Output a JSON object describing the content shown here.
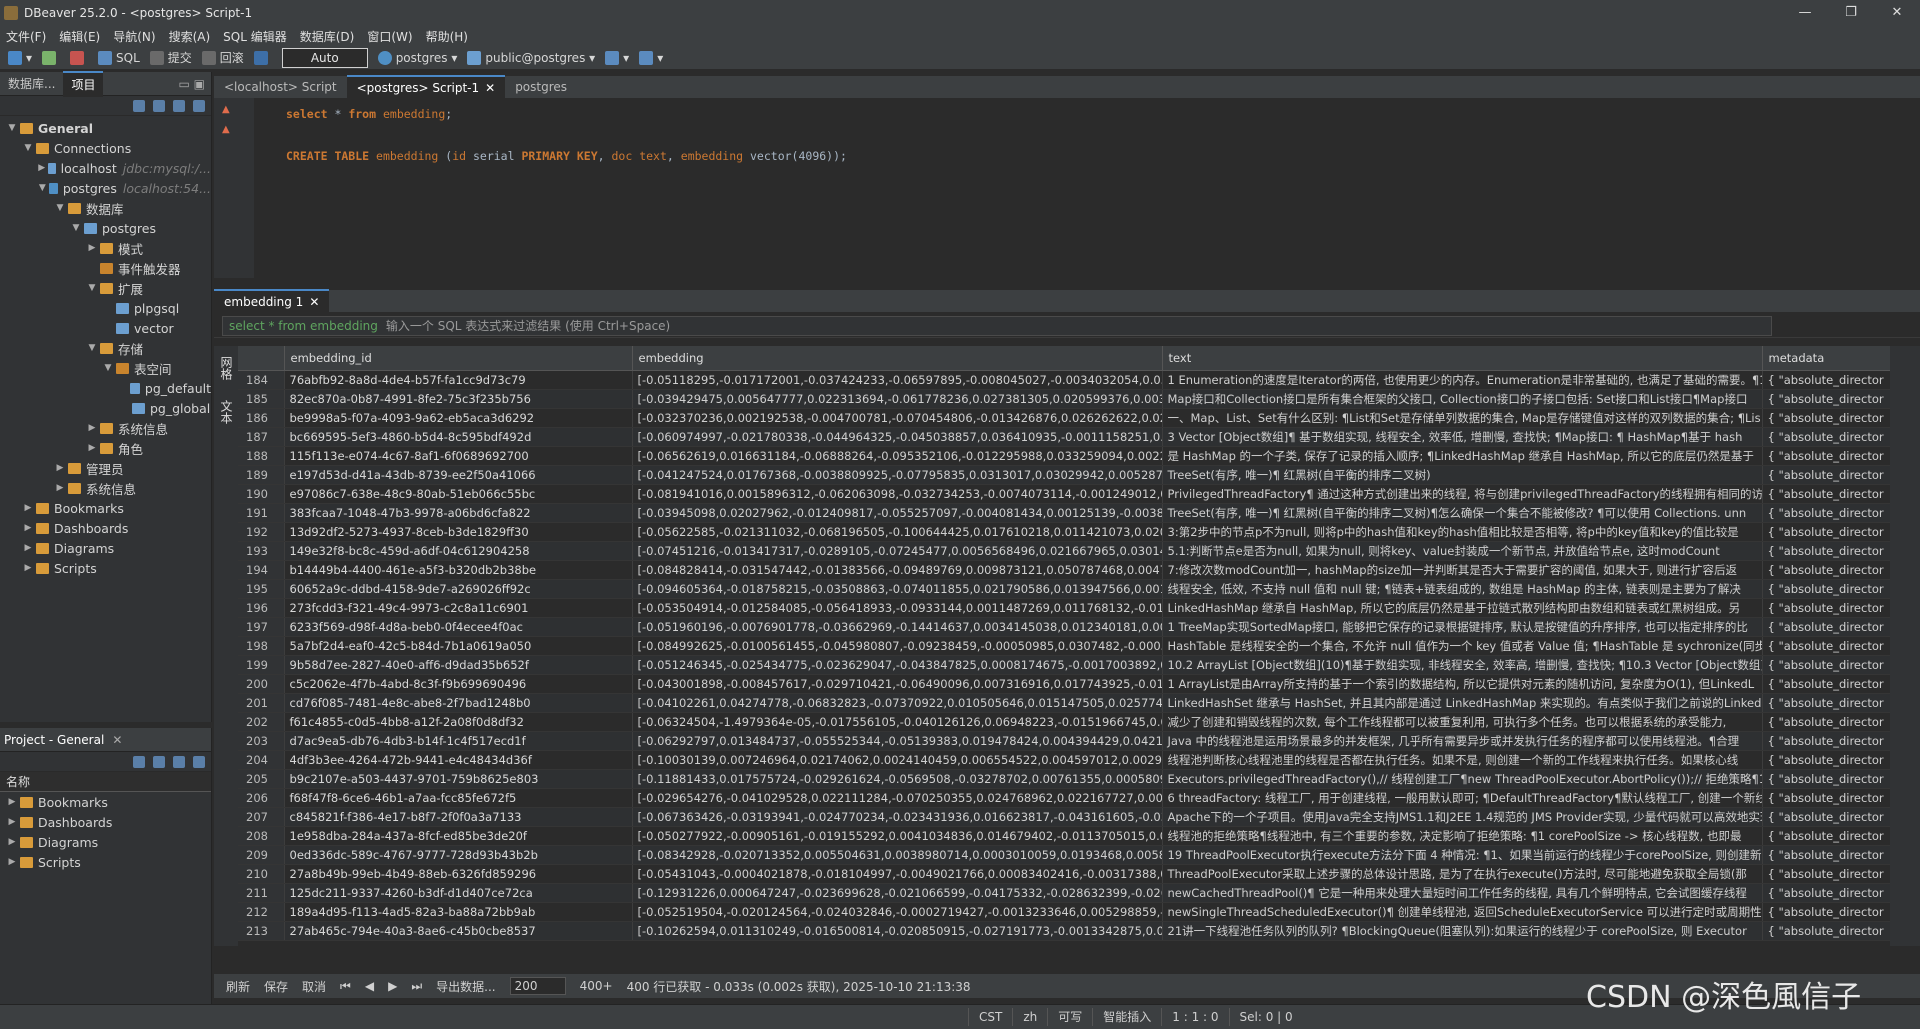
{
  "window": {
    "title": "DBeaver 25.2.0 - <postgres> Script-1",
    "controls": [
      "—",
      "❐",
      "✕"
    ]
  },
  "menu": [
    "文件(F)",
    "编辑(E)",
    "导航(N)",
    "搜索(A)",
    "SQL 编辑器",
    "数据库(D)",
    "窗口(W)",
    "帮助(H)"
  ],
  "toolbar": {
    "sql": "SQL",
    "commit": "提交",
    "rollback": "回滚",
    "auto": "Auto",
    "connection": "postgres",
    "schema": "public@postgres"
  },
  "left": {
    "tabs": [
      "数据库...",
      "项目"
    ],
    "tree": [
      {
        "label": "General",
        "level": 0,
        "arrow": "▼",
        "icon": "fold"
      },
      {
        "label": "Connections",
        "level": 1,
        "arrow": "▼",
        "icon": "fold"
      },
      {
        "label": "localhost",
        "hint": "jdbc:mysql:/...",
        "level": 2,
        "arrow": "▶",
        "icon": "dbi"
      },
      {
        "label": "postgres",
        "hint": "localhost:54...",
        "level": 2,
        "arrow": "▼",
        "icon": "pgi"
      },
      {
        "label": "数据库",
        "level": 3,
        "arrow": "▼",
        "icon": "fold"
      },
      {
        "label": "postgres",
        "level": 4,
        "arrow": "▼",
        "icon": "dbi"
      },
      {
        "label": "模式",
        "level": 5,
        "arrow": "▶",
        "icon": "fold"
      },
      {
        "label": "事件触发器",
        "level": 5,
        "arrow": "",
        "icon": "fold2"
      },
      {
        "label": "扩展",
        "level": 5,
        "arrow": "▼",
        "icon": "fold"
      },
      {
        "label": "plpgsql",
        "level": 6,
        "arrow": "",
        "icon": "dbi"
      },
      {
        "label": "vector",
        "level": 6,
        "arrow": "",
        "icon": "dbi"
      },
      {
        "label": "存储",
        "level": 5,
        "arrow": "▼",
        "icon": "fold"
      },
      {
        "label": "表空间",
        "level": 6,
        "arrow": "▼",
        "icon": "fold2"
      },
      {
        "label": "pg_default",
        "level": 7,
        "arrow": "",
        "icon": "dbi"
      },
      {
        "label": "pg_global",
        "level": 7,
        "arrow": "",
        "icon": "dbi"
      },
      {
        "label": "系统信息",
        "level": 5,
        "arrow": "▶",
        "icon": "fold"
      },
      {
        "label": "角色",
        "level": 5,
        "arrow": "▶",
        "icon": "fold"
      },
      {
        "label": "管理员",
        "level": 3,
        "arrow": "▶",
        "icon": "fold"
      },
      {
        "label": "系统信息",
        "level": 3,
        "arrow": "▶",
        "icon": "fold"
      },
      {
        "label": "Bookmarks",
        "level": 1,
        "arrow": "▶",
        "icon": "fold"
      },
      {
        "label": "Dashboards",
        "level": 1,
        "arrow": "▶",
        "icon": "fold"
      },
      {
        "label": "Diagrams",
        "level": 1,
        "arrow": "▶",
        "icon": "fold"
      },
      {
        "label": "Scripts",
        "level": 1,
        "arrow": "▶",
        "icon": "fold"
      }
    ]
  },
  "project": {
    "title": "Project - General",
    "column": "名称",
    "items": [
      "Bookmarks",
      "Dashboards",
      "Diagrams",
      "Scripts"
    ]
  },
  "editor": {
    "tabs": [
      "<localhost> Script",
      "<postgres> Script-1",
      "postgres"
    ],
    "lines": [
      {
        "parts": [
          [
            "kw",
            "select"
          ],
          [
            "tx",
            " * "
          ],
          [
            "kw",
            "from"
          ],
          [
            "tx",
            " "
          ],
          [
            "id",
            "embedding"
          ],
          [
            "tx",
            ";"
          ]
        ]
      },
      {
        "parts": []
      },
      {
        "parts": [
          [
            "kw",
            "CREATE TABLE"
          ],
          [
            "tx",
            " "
          ],
          [
            "id",
            "embedding"
          ],
          [
            "tx",
            " ("
          ],
          [
            "id",
            "id"
          ],
          [
            "tx",
            " serial "
          ],
          [
            "kw",
            "PRIMARY KEY"
          ],
          [
            "tx",
            ", "
          ],
          [
            "id",
            "doc"
          ],
          [
            "tx",
            " "
          ],
          [
            "id",
            "text"
          ],
          [
            "tx",
            ", "
          ],
          [
            "id",
            "embedding"
          ],
          [
            "tx",
            " vector(4096));"
          ]
        ]
      }
    ]
  },
  "results": {
    "tab": "embedding 1",
    "filter_sql": "select * from embedding",
    "filter_placeholder": "输入一个 SQL 表达式来过滤结果 (使用 Ctrl+Space)",
    "side_labels": [
      "网格",
      "文本"
    ],
    "columns": [
      "embedding_id",
      "embedding",
      "text",
      "metadata"
    ],
    "rows": [
      [
        "184",
        "76abfb92-8a8d-4de4-b57f-fa1cc9d73c79",
        "[-0.05118295,-0.017172001,-0.037424233,-0.06597895,-0.008045027,-0.0034032054,0.05695964,-0.0133",
        "1 Enumeration的速度是Iterator的两倍, 也使用更少的内存。Enumeration是非常基础的, 也满足了基础的需要。¶1",
        "{ \"absolute_director"
      ],
      [
        "185",
        "82ec870a-0b87-4991-8fe2-75c3f235b756",
        "[-0.039429475,0.005647777,0.022313694,-0.061778236,0.027381305,0.020599376,0.0031756589,0.00174",
        "Map接口和Collection接口是所有集合框架的父接口, Collection接口的子接口包括: Set接口和List接口¶Map接口",
        "{ \"absolute_director"
      ],
      [
        "186",
        "be9998a5-f07a-4093-9a62-eb5aca3d6292",
        "[-0.032370236,0.002192538,-0.004700781,-0.070454806,-0.013426876,0.026262622,0.024015635,-0.0109",
        "一、Map、List、Set有什么区别: ¶List和Set是存储单列数据的集合, Map是存储键值对这样的双列数据的集合; ¶Lis",
        "{ \"absolute_director"
      ],
      [
        "187",
        "bc669595-5ef3-4860-b5d4-8c595bdf492d",
        "[-0.060974997,-0.021780338,-0.044964325,-0.045038857,0.036410935,-0.0011158251,0.007193926,0.007",
        "3 Vector [Object数组]¶ 基于数组实现, 线程安全, 效率低, 增删慢, 查找快; ¶Map接口: ¶ HashMap¶基于 hash",
        "{ \"absolute_director"
      ],
      [
        "188",
        "115f113e-e074-4c67-8af1-6f0689692700",
        "[-0.06562619,0.016631184,-0.06888264,-0.095352106,-0.012295988,0.033259094,0.0022778378,0.002736",
        "是 HashMap 的一个子类, 保存了记录的插入顺序; ¶LinkedHashMap 继承自 HashMap, 所以它的底层仍然是基于",
        "{ \"absolute_director"
      ],
      [
        "189",
        "e197d53d-d41a-43db-8739-ee2f50a41066",
        "[-0.041247524,0.01767368,-0.0038809925,-0.07795835,0.0313017,0.03029942,0.0052877376,0.00107049",
        "TreeSet(有序, 唯一)¶ 红黑树(自平衡的排序二叉树)",
        "{ \"absolute_director"
      ],
      [
        "190",
        "e97086c7-638e-48c9-80ab-51eb066c55bc",
        "[-0.081941016,0.0015896312,-0.062063098,-0.032734253,-0.0074073114,-0.001249012,0.03447626,0.022",
        "PrivilegedThreadFactory¶ 通过这种方式创建出来的线程, 将与创建privilegedThreadFactory的线程拥有相同的访",
        "{ \"absolute_director"
      ],
      [
        "191",
        "383fcaa7-1048-47b3-9978-a06bd6cfa822",
        "[-0.03945098,0.02027962,-0.012409817,-0.055257097,-0.004081434,0.00125139,-0.0038218128,-0.00498",
        "TreeSet(有序, 唯一)¶ 红黑树(自平衡的排序二叉树)¶怎么确保一个集合不能被修改? ¶可以使用 Collections. unn",
        "{ \"absolute_director"
      ],
      [
        "192",
        "13d92df2-5273-4937-8ceb-b3de1829ff30",
        "[-0.05622585,-0.021311032,-0.068196505,-0.100644425,0.017610218,0.011421073,0.020693908,-0.06463",
        "3:第2步中的节点p不为null, 则将p中的hash值和key的hash值相比较是否相等, 将p中的key值和key的值比较是",
        "{ \"absolute_director"
      ],
      [
        "193",
        "149e32f8-bc8c-459d-a6df-04c612904258",
        "[-0.07451216,-0.013417317,-0.0289105,-0.07245477,0.0056568496,0.021667965,0.030141573,-0.0406302",
        "5.1:判断节点e是否为null, 如果为null, 则将key、value封装成一个新节点, 并放值给节点e, 这时modCount",
        "{ \"absolute_director"
      ],
      [
        "194",
        "b14449b4-4400-461e-a5f3-b320db2b38be",
        "[-0.084828414,-0.031547442,-0.01383566,-0.09489769,0.009873121,0.050787468,0.0047662323,0.002242",
        "7:修改次数modCount加一, hashMap的size加一并判断其是否大于需要扩容的阈值, 如果大于, 则进行扩容后返",
        "{ \"absolute_director"
      ],
      [
        "195",
        "60652a9c-ddbd-4158-9de7-a269026ff92c",
        "[-0.094605364,-0.018758215,-0.03508863,-0.074011855,0.021790586,0.013947566,0.00160223,-0.0029",
        "线程安全, 低效, 不支持 null 值和 null 键; ¶链表+链表组成的, 数组是 HashMap 的主体, 链表则是主要为了解决",
        "{ \"absolute_director"
      ],
      [
        "196",
        "273fcdd3-f321-49c4-9973-c2c8a11c6901",
        "[-0.053504914,-0.012584085,-0.056418933,-0.0933144,0.0011487269,0.011768132,-0.014254693,-0.0089",
        "LinkedHashMap 继承自 HashMap, 所以它的底层仍然是基于拉链式散列结构即由数组和链表或红黑树组成。另",
        "{ \"absolute_director"
      ],
      [
        "197",
        "6233f569-d98f-4d8a-beb0-0f4ecee4f0ac",
        "[-0.051960196,-0.0076901778,-0.03662969,-0.14414637,0.0034145038,0.012340181,0.0046085264,0.0128",
        "1 TreeMap实现SortedMap接口, 能够把它保存的记录根据键排序, 默认是按键值的升序排序, 也可以指定排序的比",
        "{ \"absolute_director"
      ],
      [
        "198",
        "5a7bf2d4-eaf0-42c5-b84d-7b1a0619a050",
        "[-0.084992625,-0.0100561455,-0.045980807,-0.09238459,-0.00050985,0.0307482,-0.00058315234,-0.0077",
        "HashTable 是线程安全的一个集合, 不允许 null 值作为一个 key 值或者 Value 值; ¶HashTable 是 sychronize(同步化",
        "{ \"absolute_director"
      ],
      [
        "199",
        "9b58d7ee-2827-40e0-aff6-d9dad35b652f",
        "[-0.051246345,-0.025434775,-0.023629047,-0.043847825,0.0008174675,-0.0017003892,0.006924023,0.03",
        "10.2 ArrayList [Object数组](10)¶基于数组实现, 非线程安全, 效率高, 增删慢, 查找快; ¶10.3 Vector [Object数组]",
        "{ \"absolute_director"
      ],
      [
        "200",
        "c5c2062e-4f7b-4abd-8c3f-f9b699690496",
        "[-0.043001898,-0.008457617,-0.029710421,-0.06490096,0.007316916,0.017743925,-0.014145091,-0.0080",
        "1 ArrayList是由Array所支持的基于一个索引的数据结构, 所以它提供对元素的随机访问, 复杂度为O(1), 但LinkedL",
        "{ \"absolute_director"
      ],
      [
        "201",
        "cd76f085-7481-4e8c-abe8-2f7bad1248b0",
        "[-0.04102261,0.04274778,-0.06832823,-0.07370922,0.010505646,0.015147505,0.025774555,-0.011507188",
        "LinkedHashSet 继承与 HashSet, 并且其内部是通过 LinkedHashMap 来实现的。有点类似于我们之前说的Linked",
        "{ \"absolute_director"
      ],
      [
        "202",
        "f61c4855-c0d5-4bb8-a12f-2a08f0d8df32",
        "[-0.06324504,-1.4979364e-05,-0.017556105,-0.040126126,0.06948223,-0.0151966745,0.006931286,-0.05",
        "减少了创建和销毁线程的次数, 每个工作线程都可以被重复利用, 可执行多个任务。也可以根据系统的承受能力,",
        "{ \"absolute_director"
      ],
      [
        "203",
        "d7ac9ea5-db76-4db3-b14f-1c4f517ecd1f",
        "[-0.06292797,0.013484737,-0.055525344,-0.05139383,0.019478424,0.004394429,0.04212634,-0.00594142",
        "Java 中的线程池是运用场景最多的并发框架, 几乎所有需要异步或并发执行任务的程序都可以使用线程池。¶合理",
        "{ \"absolute_director"
      ],
      [
        "204",
        "4df3b3ee-4264-472b-9441-e4c48434d36f",
        "[-0.10030139,0.007246964,0.02174062,0.0024140459,0.006554522,0.004597012,0.0029455153,-0.01344",
        "线程池判断核心线程池里的线程是否都在执行任务。如果不是, 则创建一个新的工作线程来执行任务。如果核心线",
        "{ \"absolute_director"
      ],
      [
        "205",
        "b9c2107e-a503-4437-9701-759b8625e803",
        "[-0.11881433,0.017575724,-0.029261624,-0.0569508,-0.03278702,0.00761355,0.0005809418,-0.00085247",
        "Executors.privilegedThreadFactory(),// 线程创建工厂¶new ThreadPoolExecutor.AbortPolicy());// 拒绝策略¶1线",
        "{ \"absolute_director"
      ],
      [
        "206",
        "f68f47f8-6ce6-46b1-a7aa-fcc85fe672f5",
        "[-0.029654276,-0.041029528,0.022111284,-0.070250355,0.024768962,0.022167727,0.0013223081,0.011122",
        "6 threadFactory: 线程工厂, 用于创建线程, 一般用默认即可; ¶DefaultThreadFactory¶默认线程工厂, 创建一个新线",
        "{ \"absolute_director"
      ],
      [
        "207",
        "c845821f-f386-4e17-b8f7-2f0f0a3a7133",
        "[-0.067363426,-0.03193941,-0.024770234,-0.023431936,0.016623817,-0.043161605,-0.039934292,0.07240",
        "Apache下的一个子项目。使用Java完全支持JMS1.1和J2EE 1.4规范的 JMS Provider实现, 少量代码就可以高效地实现",
        "{ \"absolute_director"
      ],
      [
        "208",
        "1e958dba-284a-437a-8fcf-ed85be3de20f",
        "[-0.050277922,-0.00905161,-0.019155292,0.0041034836,0.014679402,-0.0113705015,0.006129791,-0.023",
        "线程池的拒绝策略¶线程池中, 有三个重要的参数, 决定影响了拒绝策略: ¶1 corePoolSize -> 核心线程数, 也即最",
        "{ \"absolute_director"
      ],
      [
        "209",
        "0ed336dc-589c-4767-9777-728d93b43b2b",
        "[-0.08342928,-0.020713352,0.005504631,0.0038980714,0.0003010059,0.0193468,0.0058621434,-0.002887",
        "19 ThreadPoolExecutor执行execute方法分下面 4 种情况: ¶1、如果当前运行的线程少于corePoolSize, 则创建新线程",
        "{ \"absolute_director"
      ],
      [
        "210",
        "27a8b49b-99eb-4b49-88eb-6326fd859296",
        "[-0.05431043,-0.0004021878,-0.018104997,-0.0049021766,0.00083402416,-0.00317388,0.021876004,-0.02",
        "ThreadPoolExecutor采取上述步骤的总体设计思路, 是为了在执行execute()方法时, 尽可能地避免获取全局锁(那",
        "{ \"absolute_director"
      ],
      [
        "211",
        "125dc211-9337-4260-b3df-d1d407ce72ca",
        "[-0.12931226,0.000647247,-0.023699628,-0.021066599,-0.04175332,-0.028632399,-0.026702665,-0.0491",
        "newCachedThreadPool()¶ 它是一种用来处理大量短时间工作任务的线程, 具有几个鲜明特点, 它会试图缓存线程",
        "{ \"absolute_director"
      ],
      [
        "212",
        "189a4d95-f113-4ad5-82a3-ba88a72bb9ab",
        "[-0.052519504,-0.020124564,-0.024032846,-0.0002719427,-0.0013233646,0.005298859,-0.01796259,0.00",
        "newSingleThreadScheduledExecutor()¶ 创建单线程池, 返回ScheduleExecutorService 可以进行定时或周期性的工",
        "{ \"absolute_director"
      ],
      [
        "213",
        "27ab465c-794e-40a3-8ae6-c45b0cbe8537",
        "[-0.10262594,0.011310249,-0.016500814,-0.020850915,-0.027191773,-0.0013342875,0.026577974,-0.003",
        "21讲一下线程池任务队列的队列? ¶BlockingQueue(阻塞队列):如果运行的线程少于 corePoolSize, 则 Executor",
        "{ \"absolute_director"
      ]
    ]
  },
  "status": {
    "refresh": "刷新",
    "save": "保存",
    "cancel": "取消",
    "export": "导出数据...",
    "page_size": "200",
    "count": "400+",
    "summary": "400 行已获取 - 0.033s (0.002s 获取), 2025-10-10 21:13:38"
  },
  "bottom": [
    "CST",
    "zh",
    "可写",
    "智能插入",
    "1 : 1 : 0",
    "Sel: 0 | 0"
  ],
  "watermark": "CSDN @深色風信子"
}
